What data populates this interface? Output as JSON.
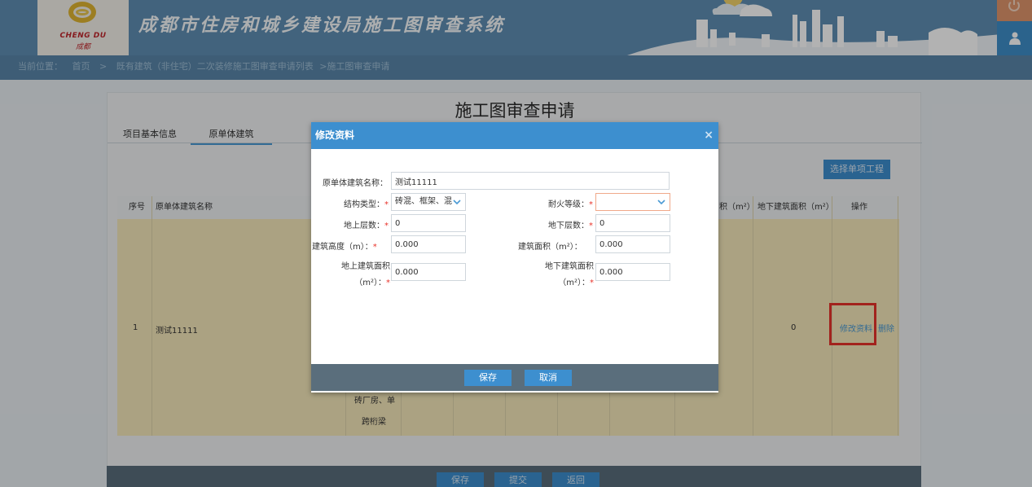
{
  "header": {
    "logo_en": "CHENG DU",
    "logo_cn": "成都",
    "system_title": "成都市住房和城乡建设局施工图审查系统",
    "power_icon": "power-icon",
    "user_icon": "user-icon"
  },
  "breadcrumb": {
    "label": "当前位置：",
    "home": "首页",
    "sep": ">",
    "list": "既有建筑（非住宅）二次装修施工图审查申请列表",
    "current": ">施工图审查申请"
  },
  "page": {
    "title": "施工图审查申请",
    "tabs": [
      {
        "label": "项目基本信息"
      },
      {
        "label": "原单体建筑"
      }
    ],
    "select_button": "选择单项工程"
  },
  "table": {
    "headers": {
      "index": "序号",
      "name": "原单体建筑名称",
      "area_partial": "积（m²）",
      "underground_area": "地下建筑面积（m²）",
      "action": "操作"
    },
    "row": {
      "index": "1",
      "name": "测试11111",
      "underground_area": "0",
      "edit": "修改资料",
      "delete": "删除",
      "structure_line1": "砖厂房、单",
      "structure_line2": "跨桁梁"
    }
  },
  "footer": {
    "save": "保存",
    "submit": "提交",
    "back": "返回"
  },
  "modal": {
    "title": "修改资料",
    "close": "×",
    "fields": {
      "name_label": "原单体建筑名称：",
      "name_value": "测试11111",
      "structure_label": "结构类型：",
      "structure_value": "砖混、框架、混",
      "fire_label": "耐火等级：",
      "fire_value": "",
      "above_floors_label": "地上层数：",
      "above_floors_value": "0",
      "below_floors_label": "地下层数：",
      "below_floors_value": "0",
      "height_label": "建筑高度（m）：",
      "height_value": "0.000",
      "area_label": "建筑面积（m²）：",
      "area_value": "0.000",
      "above_area_label_1": "地上建筑面积",
      "above_area_label_2": "（m²）：",
      "above_area_value": "0.000",
      "below_area_label_1": "地下建筑面积",
      "below_area_label_2": "（m²）：",
      "below_area_value": "0.000",
      "required_mark": "*"
    },
    "save": "保存",
    "cancel": "取消"
  },
  "colors": {
    "header_bg": "#5f8fb4",
    "accent_blue": "#3d8fcf",
    "table_row_bg": "#f5e8bb",
    "highlight_red": "#e8332a",
    "footer_bg": "#5a6e7c"
  }
}
